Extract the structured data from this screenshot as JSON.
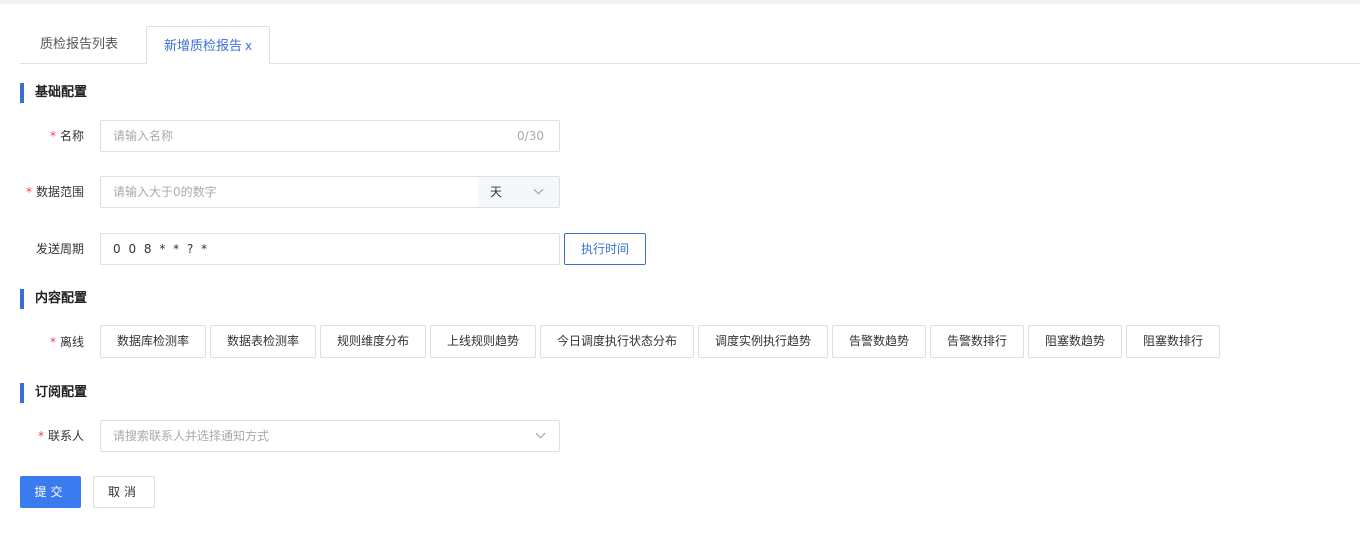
{
  "tabs": [
    {
      "label": "质检报告列表"
    },
    {
      "label": "新增质检报告",
      "close": "x"
    }
  ],
  "sections": {
    "basic": "基础配置",
    "content": "内容配置",
    "subscribe": "订阅配置"
  },
  "form": {
    "required_mark": "*",
    "name": {
      "label": "名称",
      "placeholder": "请输入名称",
      "count": "0/30"
    },
    "data_range": {
      "label": "数据范围",
      "placeholder": "请输入大于0的数字",
      "unit": "天"
    },
    "send_cycle": {
      "label": "发送周期",
      "value": "0 0 8 * * ? *",
      "button": "执行时间"
    },
    "offline": {
      "label": "离线",
      "chips": [
        "数据库检测率",
        "数据表检测率",
        "规则维度分布",
        "上线规则趋势",
        "今日调度执行状态分布",
        "调度实例执行趋势",
        "告警数趋势",
        "告警数排行",
        "阻塞数趋势",
        "阻塞数排行"
      ]
    },
    "contact": {
      "label": "联系人",
      "placeholder": "请搜索联系人并选择通知方式"
    }
  },
  "actions": {
    "submit": "提交",
    "cancel": "取消"
  },
  "colors": {
    "accent": "#3b6fd6",
    "primary_button": "#3b7bf0",
    "required": "#e5484d"
  }
}
